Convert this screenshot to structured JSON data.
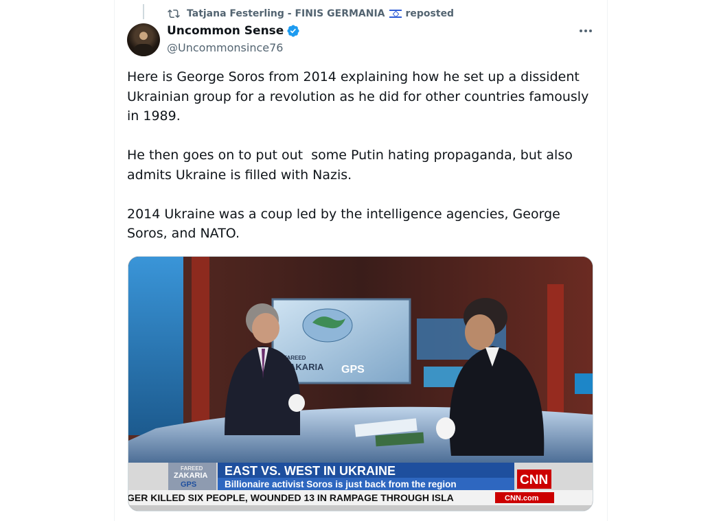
{
  "repost": {
    "user": "Tatjana Festerling - FINIS GERMANIA",
    "suffix": "reposted"
  },
  "author": {
    "name": "Uncommon Sense",
    "handle": "@Uncommonsince76"
  },
  "tweet": {
    "paragraphs": [
      "Here is George Soros from 2014 explaining how he set up a dissident Ukrainian group for a revolution as he did for other countries famously in 1989.",
      "He then goes on to put out  some Putin hating propaganda, but also admits Ukraine is filled with Nazis.",
      "2014 Ukraine was a coup led by the intelligence agencies, George Soros, and NATO."
    ]
  },
  "video": {
    "screen_logo_line1": "FAREED",
    "screen_logo_line2": "ZAKARIA",
    "screen_logo_line3": "GPS",
    "bug_line1": "FAREED",
    "bug_line2": "ZAKARIA",
    "bug_line3": "GPS",
    "headline": "EAST VS. WEST IN UKRAINE",
    "subheadline": "Billionaire activist Soros is just back from the region",
    "network": "CNN",
    "ticker": "GER KILLED SIX PEOPLE, WOUNDED 13 IN RAMPAGE THROUGH ISLA",
    "ticker_logo": "CNN.com"
  },
  "colors": {
    "accent": "#1d9bf0",
    "secondary_text": "#536471",
    "cnn_red": "#cc0000",
    "banner_blue": "#1e4f9e"
  },
  "icons": {
    "repost": "repost-icon",
    "verified": "verified-badge-icon",
    "more": "more-icon"
  }
}
